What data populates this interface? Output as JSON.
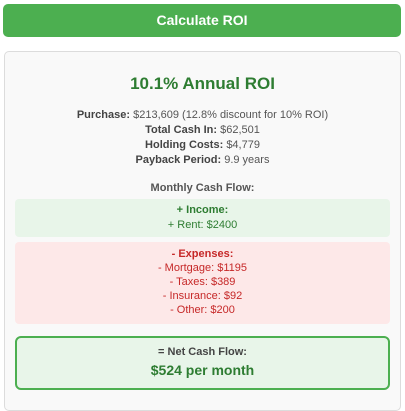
{
  "button": {
    "label": "Calculate ROI"
  },
  "results": {
    "title": "10.1% Annual ROI",
    "purchase_label": "Purchase:",
    "purchase_value": "$213,609 (12.8% discount for 10% ROI)",
    "cash_in_label": "Total Cash In:",
    "cash_in_value": "$62,501",
    "holding_label": "Holding Costs:",
    "holding_value": "$4,779",
    "payback_label": "Payback Period:",
    "payback_value": "9.9 years",
    "monthly_title": "Monthly Cash Flow:",
    "income": {
      "heading": "+ Income:",
      "items": [
        "+ Rent: $2400"
      ]
    },
    "expenses": {
      "heading": "- Expenses:",
      "items": [
        "- Mortgage: $1195",
        "- Taxes: $389",
        "- Insurance: $92",
        "- Other: $200"
      ]
    },
    "net": {
      "heading": "= Net Cash Flow:",
      "value": "$524 per month"
    }
  },
  "colors": {
    "accent": "#4CAF50",
    "positive_text": "#2e7d32",
    "negative_text": "#c62828",
    "income_bg": "#e8f5e9",
    "expense_bg": "#fde8e8"
  }
}
